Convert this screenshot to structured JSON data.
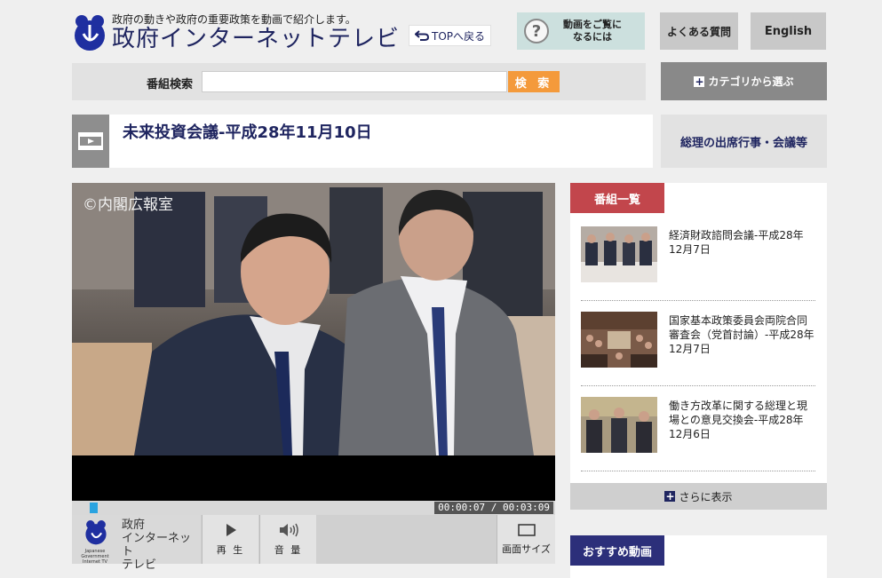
{
  "header": {
    "tagline": "政府の動きや政府の重要政策を動画で紹介します。",
    "site_title": "政府インターネットテレビ",
    "top_back_label": "TOPへ戻る",
    "help_label_line1": "動画をご覧に",
    "help_label_line2": "なるには",
    "faq_label": "よくある質問",
    "english_label": "English"
  },
  "search": {
    "label": "番組検索",
    "value": "",
    "button_label": "検 索"
  },
  "category_button_label": "カテゴリから選ぶ",
  "page_title": "未来投資会議-平成28年11月10日",
  "pm_link_label": "総理の出席行事・会議等",
  "player": {
    "copyright": "©内閣広報室",
    "progress_fraction": 0.04,
    "current_time": "00:00:07",
    "total_time": "00:03:09",
    "time_display": "00:00:07 / 00:03:09",
    "logo_text": "政府\nインターネット\nテレビ",
    "logo_small_text": "Japanese Government Internet TV",
    "play_label": "再 生",
    "volume_label": "音 量",
    "size_label": "画面サイズ"
  },
  "sidebar": {
    "list_header": "番組一覧",
    "items": [
      {
        "title": "経済財政諮問会議-平成28年12月7日"
      },
      {
        "title": "国家基本政策委員会両院合同審査会（党首討論）-平成28年12月7日"
      },
      {
        "title": "働き方改革に関する総理と現場との意見交換会-平成28年12月6日"
      }
    ],
    "more_label": "さらに表示",
    "recommend_header": "おすすめ動画"
  },
  "colors": {
    "navy": "#1f2560",
    "orange": "#f49a3b",
    "red_header": "#c2464c",
    "blue_header": "#2c2f7a",
    "progress": "#2aa3e0"
  }
}
